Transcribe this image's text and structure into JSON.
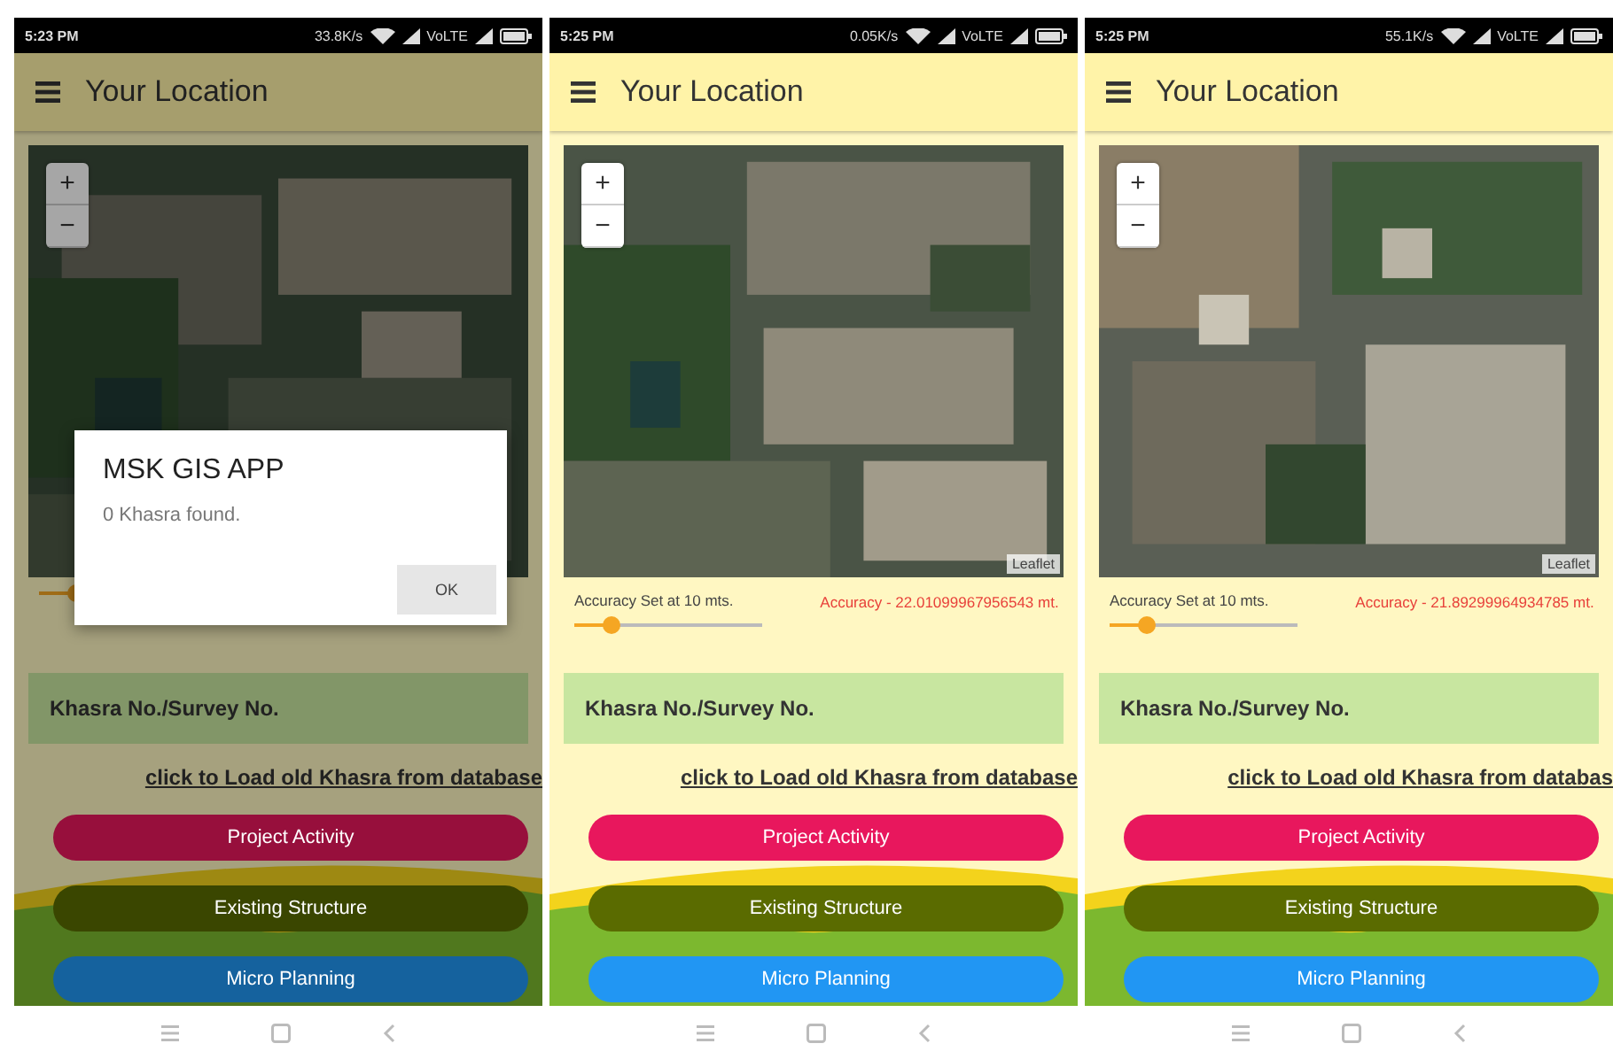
{
  "phones": [
    {
      "status_bar": {
        "time": "5:23 PM",
        "speed": "33.8K/s",
        "network": "VoLTE"
      },
      "app_bar": {
        "title": "Your Location"
      },
      "map": {
        "zoom_in": "+",
        "zoom_out": "−"
      },
      "slider": {
        "level": 0.2
      },
      "khasra_field": {
        "placeholder": "Khasra No./Survey No."
      },
      "load_link": "click to Load old Khasra from database",
      "buttons": [
        {
          "label": "Project Activity",
          "color": "#970f3c"
        },
        {
          "label": "Existing Structure",
          "color": "#3a4600"
        },
        {
          "label": "Micro Planning",
          "color": "#15629e"
        }
      ],
      "dialog": {
        "title": "MSK GIS APP",
        "message": "0 Khasra found.",
        "button": "OK"
      }
    },
    {
      "status_bar": {
        "time": "5:25 PM",
        "speed": "0.05K/s",
        "network": "VoLTE"
      },
      "app_bar": {
        "title": "Your Location"
      },
      "map": {
        "zoom_in": "+",
        "zoom_out": "−",
        "attribution": "Leaflet"
      },
      "accuracy": {
        "setting": "Accuracy Set at 10 mts.",
        "reading": "Accuracy - 22.01099967956543 mt."
      },
      "slider": {
        "level": 0.2
      },
      "khasra_field": {
        "placeholder": "Khasra No./Survey No."
      },
      "load_link": "click to Load old Khasra from database",
      "buttons": [
        {
          "label": "Project Activity",
          "color": "#e8175d"
        },
        {
          "label": "Existing Structure",
          "color": "#5a6b00"
        },
        {
          "label": "Micro Planning",
          "color": "#2196f3"
        }
      ]
    },
    {
      "status_bar": {
        "time": "5:25 PM",
        "speed": "55.1K/s",
        "network": "VoLTE"
      },
      "app_bar": {
        "title": "Your Location"
      },
      "map": {
        "zoom_in": "+",
        "zoom_out": "−",
        "attribution": "Leaflet"
      },
      "accuracy": {
        "setting": "Accuracy Set at 10 mts.",
        "reading": "Accuracy - 21.89299964934785 mt."
      },
      "slider": {
        "level": 0.2
      },
      "khasra_field": {
        "placeholder": "Khasra No./Survey No."
      },
      "load_link": "click to Load old Khasra from databas",
      "buttons": [
        {
          "label": "Project Activity",
          "color": "#e8175d"
        },
        {
          "label": "Existing Structure",
          "color": "#5a6b00"
        },
        {
          "label": "Micro Planning",
          "color": "#2196f3"
        }
      ]
    }
  ]
}
